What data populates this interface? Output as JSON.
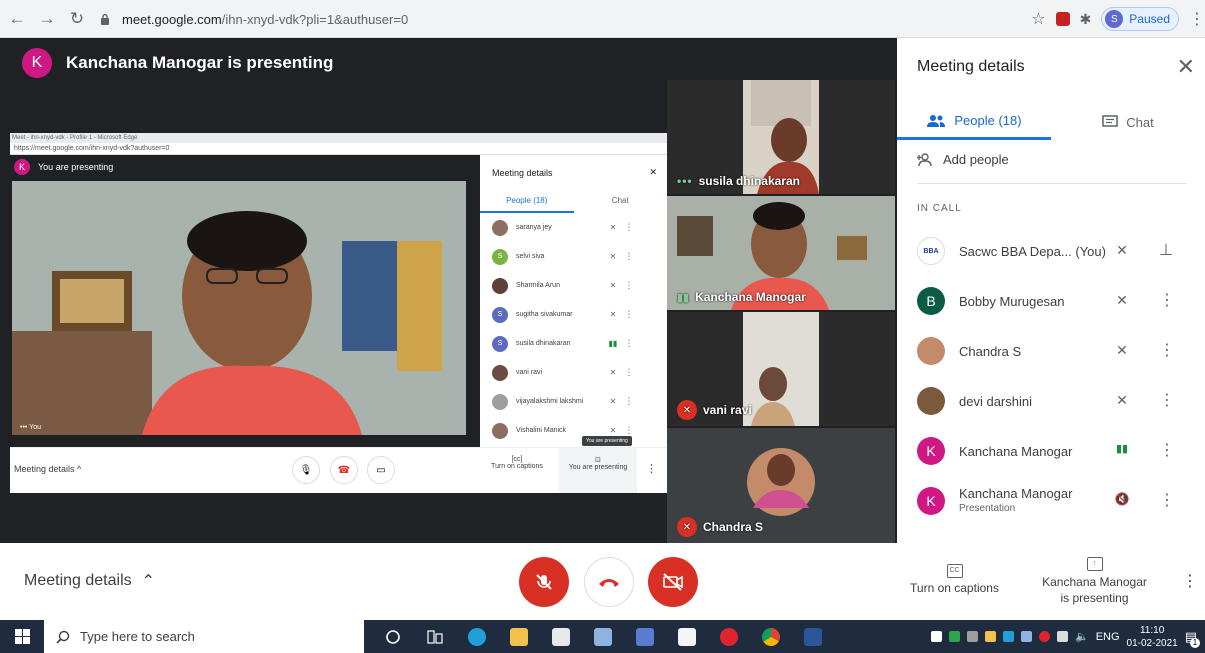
{
  "browser": {
    "url_host": "meet.google.com",
    "url_path": "/ihn-xnyd-vdk?pli=1&authuser=0",
    "profile_initial": "S",
    "profile_status": "Paused"
  },
  "stage": {
    "presenter_initial": "K",
    "presenter_text": "Kanchana Manogar is presenting"
  },
  "shared_screen": {
    "window_title": "Meet - ihn-xnyd-vdk - Profile 1 - Microsoft Edge",
    "url": "https://meet.google.com/ihn-xnyd-vdk?authuser=0",
    "presenting_initial": "K",
    "presenting_text": "You are presenting",
    "you_label": "You",
    "panel_title": "Meeting details",
    "tab_people": "People (18)",
    "tab_chat": "Chat",
    "people": [
      {
        "name": "saranya jey",
        "initial": "",
        "color": "#8d6e63"
      },
      {
        "name": "selvi siva",
        "initial": "S",
        "color": "#7cb342"
      },
      {
        "name": "Sharmila Arun",
        "initial": "",
        "color": "#5d4037"
      },
      {
        "name": "sugitha sivakumar",
        "initial": "S",
        "color": "#5c6bc0"
      },
      {
        "name": "susila dhinakaran",
        "initial": "S",
        "color": "#5c6bc0"
      },
      {
        "name": "vani ravi",
        "initial": "",
        "color": "#6d4c41"
      },
      {
        "name": "vijayalakshmi lakshmi",
        "initial": "",
        "color": "#9e9e9e"
      },
      {
        "name": "Vishalini Manick",
        "initial": "",
        "color": "#8d6e63"
      }
    ],
    "bottom_details": "Meeting details",
    "bottom_captions": "Turn on captions",
    "bottom_presenting": "You are presenting",
    "tooltip": "You are presenting"
  },
  "tiles": [
    {
      "name": "susila dhinakaran",
      "status": "dots"
    },
    {
      "name": "Kanchana Manogar",
      "status": "speaking"
    },
    {
      "name": "vani ravi",
      "status": "muted"
    },
    {
      "name": "Chandra S",
      "status": "muted"
    }
  ],
  "bottombar": {
    "details_label": "Meeting details"
  },
  "panel": {
    "title": "Meeting details",
    "tab_people": "People (18)",
    "tab_chat": "Chat",
    "add_people": "Add people",
    "in_call": "IN CALL",
    "participants": [
      {
        "name": "Sacwc BBA Depa...",
        "you": "(You)",
        "sub": "",
        "initial": "BBA",
        "color": "#ffffff",
        "mic": "muted",
        "action": "pin"
      },
      {
        "name": "Bobby Murugesan",
        "you": "",
        "sub": "",
        "initial": "B",
        "color": "#0b5c44",
        "mic": "muted",
        "action": "more"
      },
      {
        "name": "Chandra S",
        "you": "",
        "sub": "",
        "initial": "",
        "color": "#c48b6a",
        "mic": "muted",
        "action": "more"
      },
      {
        "name": "devi darshini",
        "you": "",
        "sub": "",
        "initial": "",
        "color": "#7a5a3a",
        "mic": "muted",
        "action": "more"
      },
      {
        "name": "Kanchana Manogar",
        "you": "",
        "sub": "",
        "initial": "K",
        "color": "#d01884",
        "mic": "speaking",
        "action": "more"
      },
      {
        "name": "Kanchana Manogar",
        "you": "",
        "sub": "Presentation",
        "initial": "K",
        "color": "#d01884",
        "mic": "muted-speaker",
        "action": "more"
      }
    ]
  },
  "controls": {
    "captions_label": "Turn on captions",
    "presenting_label": "Kanchana Manogar is presenting"
  },
  "taskbar": {
    "search_placeholder": "Type here to search",
    "lang": "ENG",
    "time": "11:10",
    "date": "01-02-2021",
    "notification_count": "1"
  }
}
